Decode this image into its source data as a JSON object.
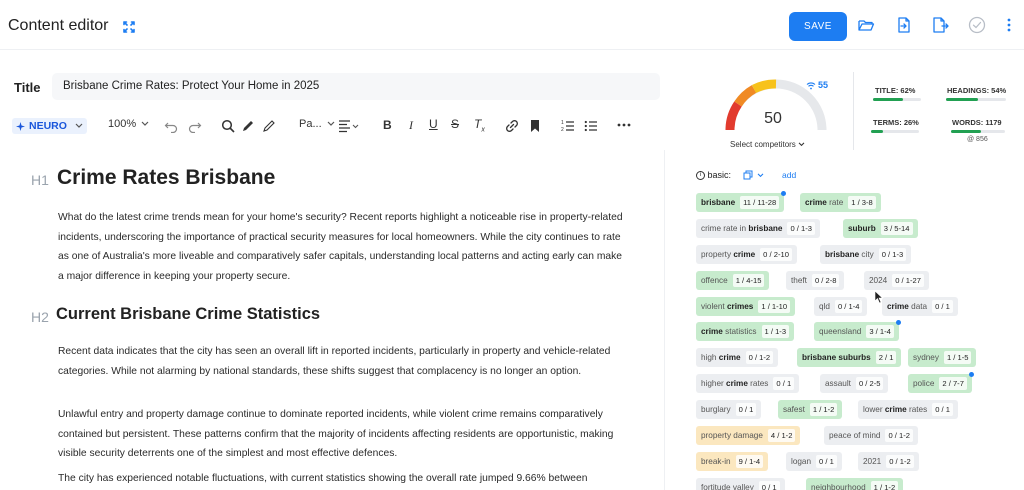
{
  "header": {
    "title": "Content editor",
    "save_label": "SAVE"
  },
  "title_field": {
    "label": "Title",
    "value": "Brisbane Crime Rates: Protect Your Home in 2025"
  },
  "toolbar": {
    "neuro_label": "NEURO",
    "zoom": "100%",
    "paragraph_style": "Pa..."
  },
  "editor": {
    "h1_tag": "H1",
    "h1_text": "Crime Rates Brisbane",
    "p1": "What do the latest crime trends mean for your home's security? Recent reports highlight a noticeable rise in property-related incidents, underscoring the importance of practical security measures for local homeowners. While the city continues to rate as one of Australia's more liveable and comparatively safer capitals, understanding local patterns and acting early can make a major difference in keeping your property secure.",
    "h2_tag": "H2",
    "h2_text": "Current Brisbane Crime Statistics",
    "p2": "Recent data indicates that the city has seen an overall lift in reported incidents, particularly in property and vehicle-related categories. While not alarming by national standards, these shifts suggest that complacency is no longer an option.",
    "p3": "Unlawful entry and property damage continue to dominate reported incidents, while violent crime remains comparatively contained but persistent. These patterns confirm that the majority of incidents affecting residents are opportunistic, making visible security deterrents one of the simplest and most effective defences.",
    "p4": "The city has experienced notable fluctuations, with current statistics showing the overall rate jumped 9.66% between"
  },
  "score": {
    "value": "50",
    "competitors_signal": "55",
    "select_competitors": "Select competitors",
    "level": 0.5
  },
  "stats": {
    "title_label": "TITLE: 62%",
    "title_pct": 0.62,
    "headings_label": "HEADINGS: 54%",
    "headings_pct": 0.54,
    "terms_label": "TERMS: 26%",
    "terms_pct": 0.26,
    "words_label": "WORDS: 1179",
    "words_pct": 0.55,
    "words_target": "@ 856"
  },
  "keywords_header": {
    "basic_label": "basic:",
    "add_label": "add"
  },
  "keywords": [
    {
      "pre": "",
      "bold": "brisbane",
      "post": "",
      "count": "11 / 11-28",
      "style": "green",
      "dot": true
    },
    {
      "pre": "",
      "bold": "crime",
      "post": " rate",
      "count": "1 / 3-8",
      "style": "green",
      "dot": false
    },
    {
      "pre": "crime rate in ",
      "bold": "brisbane",
      "post": "",
      "count": "0 / 1-3",
      "style": "gray",
      "dot": false
    },
    {
      "pre": "",
      "bold": "suburb",
      "post": "",
      "count": "3 / 5-14",
      "style": "green",
      "dot": false
    },
    {
      "pre": "property ",
      "bold": "crime",
      "post": "",
      "count": "0 / 2-10",
      "style": "gray",
      "dot": false
    },
    {
      "pre": "",
      "bold": "brisbane",
      "post": " city",
      "count": "0 / 1-3",
      "style": "gray",
      "dot": false
    },
    {
      "pre": "offence",
      "bold": "",
      "post": "",
      "count": "1 / 4-15",
      "style": "green",
      "dot": false
    },
    {
      "pre": "theft",
      "bold": "",
      "post": "",
      "count": "0 / 2-8",
      "style": "gray",
      "dot": false
    },
    {
      "pre": "2024",
      "bold": "",
      "post": "",
      "count": "0 / 1-27",
      "style": "gray",
      "dot": false
    },
    {
      "pre": "violent ",
      "bold": "crimes",
      "post": "",
      "count": "1 / 1-10",
      "style": "green",
      "dot": false
    },
    {
      "pre": "qld",
      "bold": "",
      "post": "",
      "count": "0 / 1-4",
      "style": "gray",
      "dot": false
    },
    {
      "pre": "",
      "bold": "crime",
      "post": " data",
      "count": "0 / 1",
      "style": "gray",
      "dot": false
    },
    {
      "pre": "",
      "bold": "crime",
      "post": " statistics",
      "count": "1 / 1-3",
      "style": "green",
      "dot": false
    },
    {
      "pre": "queensland",
      "bold": "",
      "post": "",
      "count": "3 / 1-4",
      "style": "green",
      "dot": true
    },
    {
      "pre": "high ",
      "bold": "crime",
      "post": "",
      "count": "0 / 1-2",
      "style": "gray",
      "dot": false
    },
    {
      "pre": "",
      "bold": "brisbane suburbs",
      "post": "",
      "count": "2 / 1",
      "style": "green",
      "dot": false
    },
    {
      "pre": "sydney",
      "bold": "",
      "post": "",
      "count": "1 / 1-5",
      "style": "green",
      "dot": false
    },
    {
      "pre": "higher ",
      "bold": "crime",
      "post": " rates",
      "count": "0 / 1",
      "style": "gray",
      "dot": false
    },
    {
      "pre": "assault",
      "bold": "",
      "post": "",
      "count": "0 / 2-5",
      "style": "gray",
      "dot": false
    },
    {
      "pre": "police",
      "bold": "",
      "post": "",
      "count": "2 / 7-7",
      "style": "green",
      "dot": true
    },
    {
      "pre": "burglary",
      "bold": "",
      "post": "",
      "count": "0 / 1",
      "style": "gray",
      "dot": false
    },
    {
      "pre": "safest",
      "bold": "",
      "post": "",
      "count": "1 / 1-2",
      "style": "green",
      "dot": false
    },
    {
      "pre": "lower ",
      "bold": "crime",
      "post": " rates",
      "count": "0 / 1",
      "style": "gray",
      "dot": false
    },
    {
      "pre": "property damage",
      "bold": "",
      "post": "",
      "count": "4 / 1-2",
      "style": "yellow",
      "dot": false
    },
    {
      "pre": "peace of mind",
      "bold": "",
      "post": "",
      "count": "0 / 1-2",
      "style": "gray",
      "dot": false
    },
    {
      "pre": "break-in",
      "bold": "",
      "post": "",
      "count": "9 / 1-4",
      "style": "yellow",
      "dot": false
    },
    {
      "pre": "logan",
      "bold": "",
      "post": "",
      "count": "0 / 1",
      "style": "gray",
      "dot": false
    },
    {
      "pre": "2021",
      "bold": "",
      "post": "",
      "count": "0 / 1-2",
      "style": "gray",
      "dot": false
    },
    {
      "pre": "fortitude valley",
      "bold": "",
      "post": "",
      "count": "0 / 1",
      "style": "gray",
      "dot": false
    },
    {
      "pre": "neighbourhood",
      "bold": "",
      "post": "",
      "count": "1 / 1-2",
      "style": "green",
      "dot": false
    }
  ],
  "colors": {
    "accent": "#1d7df2",
    "chip_green": "#c7ebcd",
    "chip_gray": "#eceef1",
    "chip_yellow": "#fbe7bf",
    "bar_green": "#22a052"
  }
}
